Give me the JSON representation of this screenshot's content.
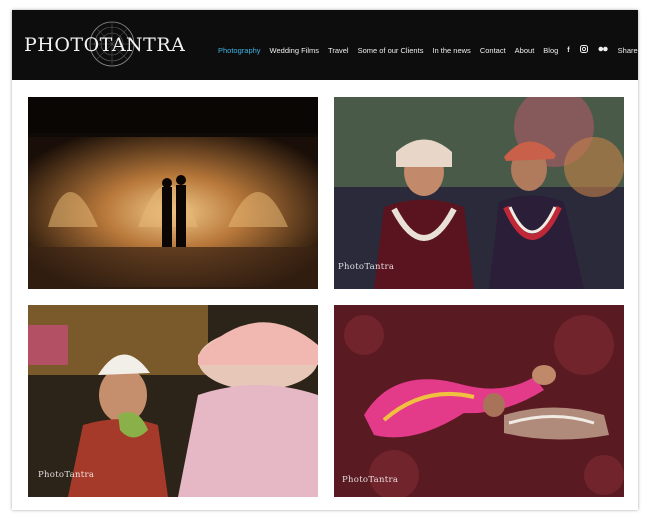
{
  "site": {
    "logo_text": "PhotoTantra",
    "logo_display": "PHOTOTANTRA"
  },
  "nav": {
    "items": [
      {
        "label": "Photography",
        "active": true
      },
      {
        "label": "Wedding Films"
      },
      {
        "label": "Travel"
      },
      {
        "label": "Some of our Clients"
      },
      {
        "label": "In the news"
      },
      {
        "label": "Contact"
      },
      {
        "label": "About"
      },
      {
        "label": "Blog"
      }
    ],
    "social_icons": [
      "facebook-icon",
      "instagram-icon",
      "flickr-icon"
    ],
    "share_label": "Share"
  },
  "gallery": {
    "watermark": "PhotoTantra"
  },
  "colors": {
    "accent": "#3fb4e5",
    "header_bg": "#0d0d0d"
  }
}
